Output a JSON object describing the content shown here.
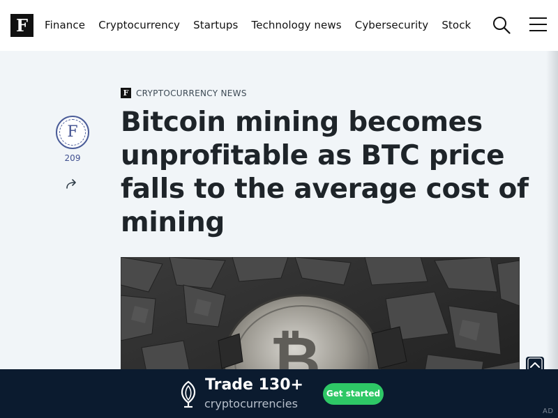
{
  "header": {
    "logo_letter": "F",
    "nav": [
      "Finance",
      "Cryptocurrency",
      "Startups",
      "Technology news",
      "Cybersecurity",
      "Stock"
    ]
  },
  "sidebar": {
    "avatar_letter": "F",
    "count": "209"
  },
  "article": {
    "category_logo": "F",
    "category": "CRYPTOCURRENCY NEWS",
    "title": "Bitcoin mining becomes unprofitable as BTC price falls to the average cost of mining"
  },
  "ad": {
    "headline": "Trade 130+",
    "subline": "cryptocurrencies",
    "cta": "Get started",
    "tag": "AD"
  },
  "icons": {
    "search": "search-icon",
    "menu": "hamburger-menu-icon",
    "share": "share-icon",
    "collapse": "chevron-up-icon"
  }
}
